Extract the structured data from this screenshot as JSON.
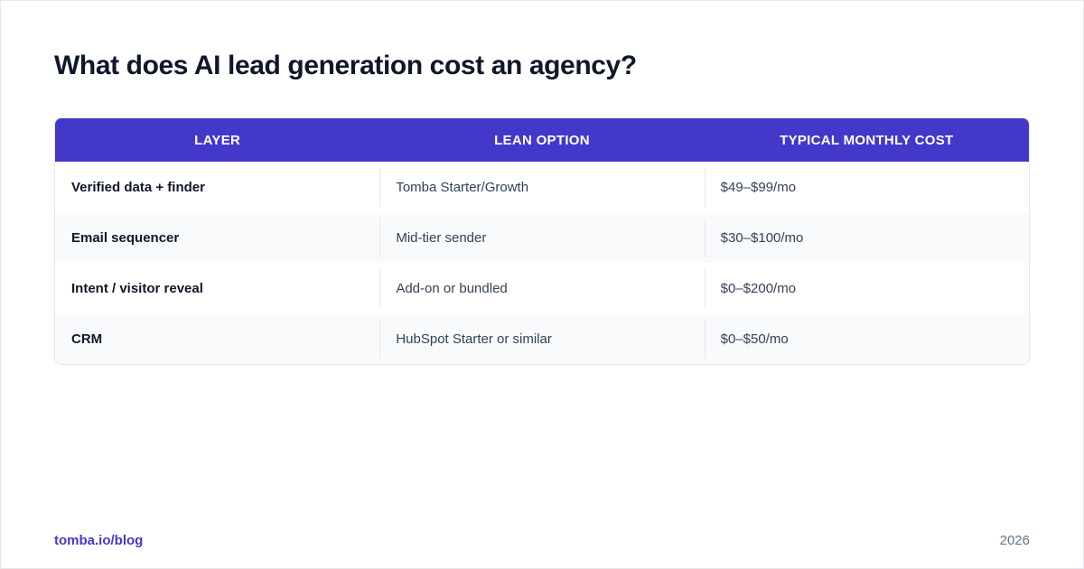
{
  "title": "What does AI lead generation cost an agency?",
  "colors": {
    "header_bg": "#4338ca",
    "accent": "#4338ca",
    "alt_row": "#f8fafc"
  },
  "table": {
    "headers": [
      "LAYER",
      "LEAN OPTION",
      "TYPICAL MONTHLY COST"
    ],
    "rows": [
      [
        "Verified data + finder",
        "Tomba Starter/Growth",
        "$49–$99/mo"
      ],
      [
        "Email sequencer",
        "Mid-tier sender",
        "$30–$100/mo"
      ],
      [
        "Intent / visitor reveal",
        "Add-on or bundled",
        "$0–$200/mo"
      ],
      [
        "CRM",
        "HubSpot Starter or similar",
        "$0–$50/mo"
      ]
    ]
  },
  "footer": {
    "source": "tomba.io/blog",
    "year": "2026"
  }
}
